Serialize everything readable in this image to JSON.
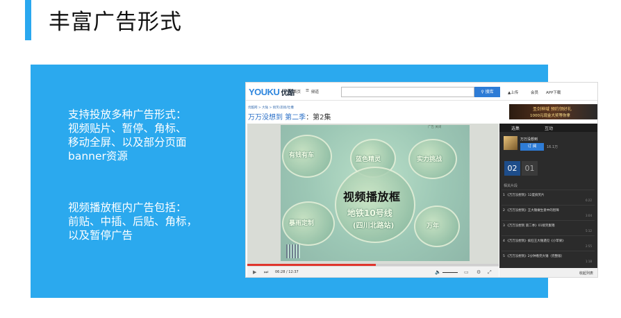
{
  "slide": {
    "title": "丰富广告形式",
    "desc1": "支持投放多种广告形式：\n视频贴片、暂停、角标、\n移动全屏、以及部分页面\nbanner资源",
    "desc2": "视频播放框内广告包括：\n前贴、中插、后贴、角标，\n以及暂停广告"
  },
  "site": {
    "logo_en": "YOUKU",
    "logo_cn": "优酷",
    "nav_home": "首页",
    "nav_channel": "频道",
    "search_btn": "搜库",
    "upload": "上传",
    "member": "会员",
    "app": "APP下载",
    "breadcrumb": "优酷网 > 大陆 > 搞笑/恶搞/吐槽",
    "video_title_blue": "万万没想到 第二季",
    "video_title_rest": "：第2集",
    "banner_line1": "圣剑神域 预约领好礼",
    "banner_line2": "1000元现金大奖等你拿"
  },
  "player": {
    "label": "视频播放框",
    "badges": [
      "有钱有车",
      "蓝色精灵",
      "实力挑战",
      "暴雨定制",
      "万年"
    ],
    "center_badge": "地铁10号线",
    "center_sub": "(四川北路站)",
    "time": "06:28 / 12:37",
    "progress": 0.51,
    "top_strip": "广告 关闭"
  },
  "sidebar": {
    "tab_select": "选集",
    "tab_interact": "互动",
    "channel": "万万没想到",
    "subscribe": "订 阅",
    "sub_count": "16.1万",
    "ep1": "02",
    "ep2": "01",
    "section": "相关片段",
    "clips": [
      {
        "title": "1 《万万没想到》12度搞笑片",
        "meta": "6:22"
      },
      {
        "title": "2 《万万没想到》王大锤做生意中的智障",
        "meta": "3:04"
      },
      {
        "title": "3 《万万没想到 第二季》01搞笑集锦",
        "meta": "5:12"
      },
      {
        "title": "4 《万万没想到》疯狂王大锤遇见《小苹果》",
        "meta": "2:55"
      },
      {
        "title": "5 《万万没想到》2分钟看完大锤（完整版）",
        "meta": "1:18"
      }
    ],
    "footer": "收起列表"
  },
  "colors": {
    "accent": "#2aa8ef",
    "panel": "#2ba9ee",
    "youku_blue": "#2e7cd6",
    "progress": "#e0342c"
  }
}
